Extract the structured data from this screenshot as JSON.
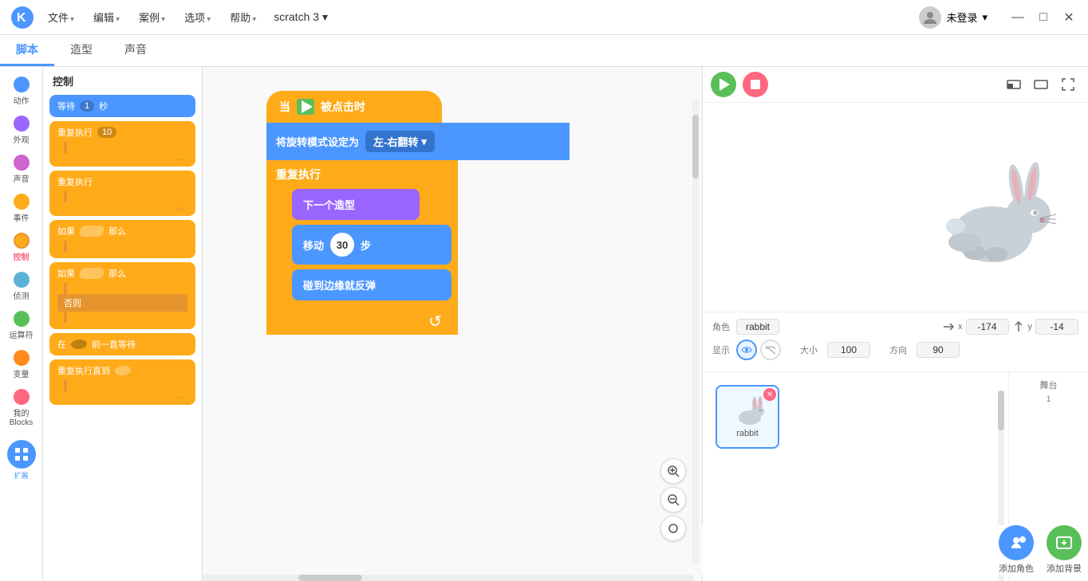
{
  "app": {
    "title": "scratch 3",
    "title_arrow": "▾"
  },
  "menu": {
    "file": "文件",
    "edit": "编辑",
    "examples": "案例",
    "options": "选项",
    "help": "帮助",
    "file_arrow": "▾",
    "edit_arrow": "▾",
    "examples_arrow": "▾",
    "options_arrow": "▾",
    "help_arrow": "▾",
    "title_arrow": "▾"
  },
  "user": {
    "label": "未登录",
    "arrow": "▾"
  },
  "window_controls": {
    "minimize": "—",
    "maximize": "□",
    "close": "✕"
  },
  "tabs": {
    "code": "脚本",
    "costume": "造型",
    "sound": "声音"
  },
  "categories": [
    {
      "label": "动作",
      "color": "#4c97ff"
    },
    {
      "label": "外观",
      "color": "#9966ff"
    },
    {
      "label": "声音",
      "color": "#cf63cf"
    },
    {
      "label": "事件",
      "color": "#ffab19"
    },
    {
      "label": "控制",
      "color": "#ffab19"
    },
    {
      "label": "侦测",
      "color": "#5cb1d6"
    },
    {
      "label": "运算符",
      "color": "#59c059"
    },
    {
      "label": "变量",
      "color": "#ff8c1a"
    },
    {
      "label": "我的\nBlocks",
      "color": "#ff6680"
    }
  ],
  "palette": {
    "title": "控制",
    "blocks": [
      {
        "text": "等待",
        "input": "1",
        "suffix": "秒",
        "type": "blue"
      },
      {
        "text": "重复执行",
        "input": "10",
        "type": "c-orange"
      },
      {
        "text": "重复执行",
        "type": "c-orange-plain"
      },
      {
        "text": "如果",
        "sub": "那么",
        "type": "if-orange"
      },
      {
        "text": "如果",
        "sub": "那么",
        "else": "否则",
        "type": "if-else-orange"
      },
      {
        "text": "在",
        "input2": "前一直等待",
        "type": "orange-diamond"
      },
      {
        "text": "重复执行直到",
        "input3": "",
        "type": "c-orange-until"
      }
    ]
  },
  "workspace": {
    "hat_label": "当",
    "hat_flag": "🏴",
    "hat_suffix": "被点击时",
    "rotation_label": "将旋转模式设定为",
    "rotation_value": "左-右翻转",
    "rotation_arrow": "▾",
    "repeat_label": "重复执行",
    "next_costume": "下一个造型",
    "move_label": "移动",
    "move_steps": "30",
    "move_suffix": "步",
    "bounce_label": "碰到边缘就反弹",
    "end_icon": "↺"
  },
  "stage_controls": {
    "green_flag_title": "绿旗",
    "stop_title": "停止"
  },
  "sprite_props": {
    "role_label": "角色",
    "sprite_name": "rabbit",
    "x_label": "x",
    "x_value": "-174",
    "y_label": "y",
    "y_value": "-14",
    "show_label": "显示",
    "size_label": "大小",
    "size_value": "100",
    "direction_label": "方向",
    "direction_value": "90"
  },
  "sprite_list": {
    "sprite_name": "rabbit"
  },
  "stage_panel": {
    "label": "舞台",
    "backdrop_count": "1"
  },
  "bottom_buttons": {
    "add_sprite": "添加角色",
    "add_backdrop": "添加背景"
  },
  "zoom_controls": {
    "zoom_in": "+",
    "zoom_out": "−",
    "zoom_reset": "○"
  }
}
